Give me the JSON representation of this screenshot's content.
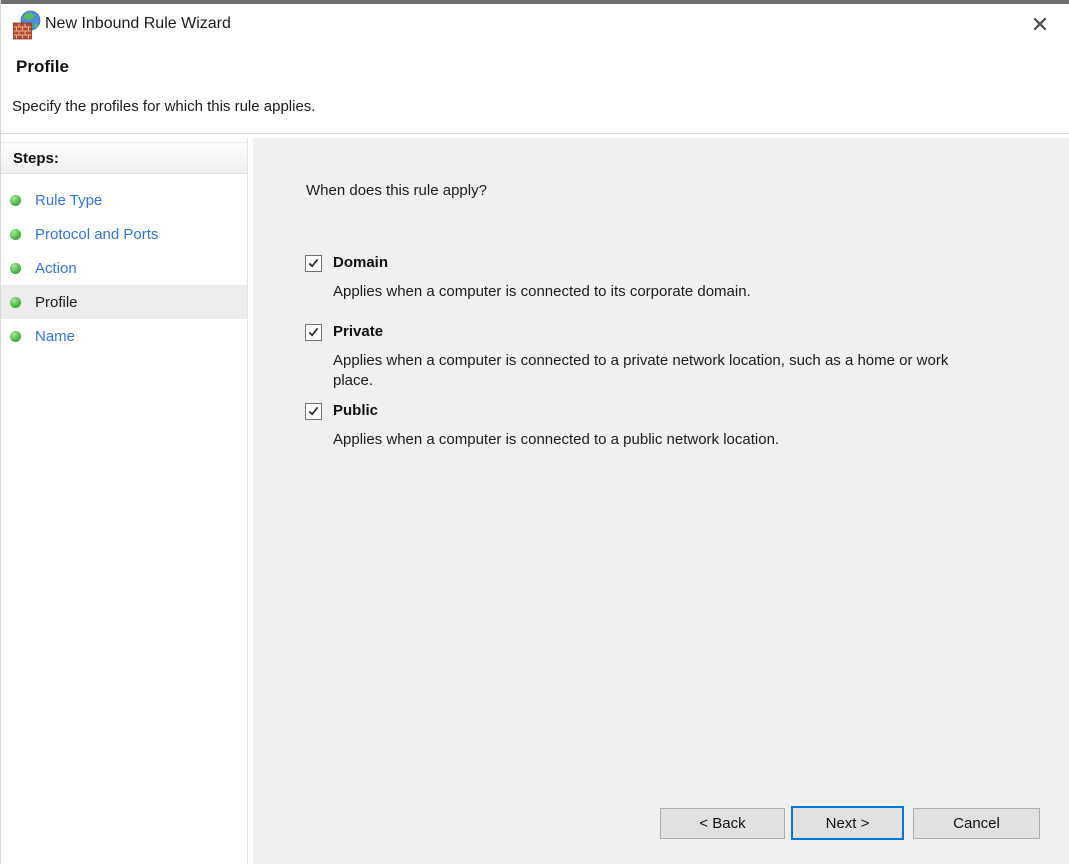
{
  "window": {
    "title": "New Inbound Rule Wizard",
    "icons": {
      "close_glyph": "✕",
      "app_icon": "firewall-globe"
    }
  },
  "header": {
    "title": "Profile",
    "subtitle": "Specify the profiles for which this rule applies."
  },
  "sidebar": {
    "heading": "Steps:",
    "items": [
      {
        "label": "Rule Type",
        "state": "completed-link"
      },
      {
        "label": "Protocol and Ports",
        "state": "completed-link"
      },
      {
        "label": "Action",
        "state": "completed-link"
      },
      {
        "label": "Profile",
        "state": "current"
      },
      {
        "label": "Name",
        "state": "link"
      }
    ]
  },
  "main": {
    "question": "When does this rule apply?",
    "profiles": [
      {
        "label": "Domain",
        "checked": true,
        "description": "Applies when a computer is connected to its corporate domain."
      },
      {
        "label": "Private",
        "checked": true,
        "description": "Applies when a computer is connected to a private network location, such as a home or work place."
      },
      {
        "label": "Public",
        "checked": true,
        "description": "Applies when a computer is connected to a public network location."
      }
    ]
  },
  "footer": {
    "back_label": "< Back",
    "next_label": "Next >",
    "cancel_label": "Cancel"
  },
  "colors": {
    "link": "#3575d3",
    "step_bullet_green": "#4db848",
    "default_button_border": "#0078d7",
    "content_bg": "#f0f0f0",
    "button_bg": "#e1e1e1",
    "top_strip": "#6e6e6e"
  }
}
